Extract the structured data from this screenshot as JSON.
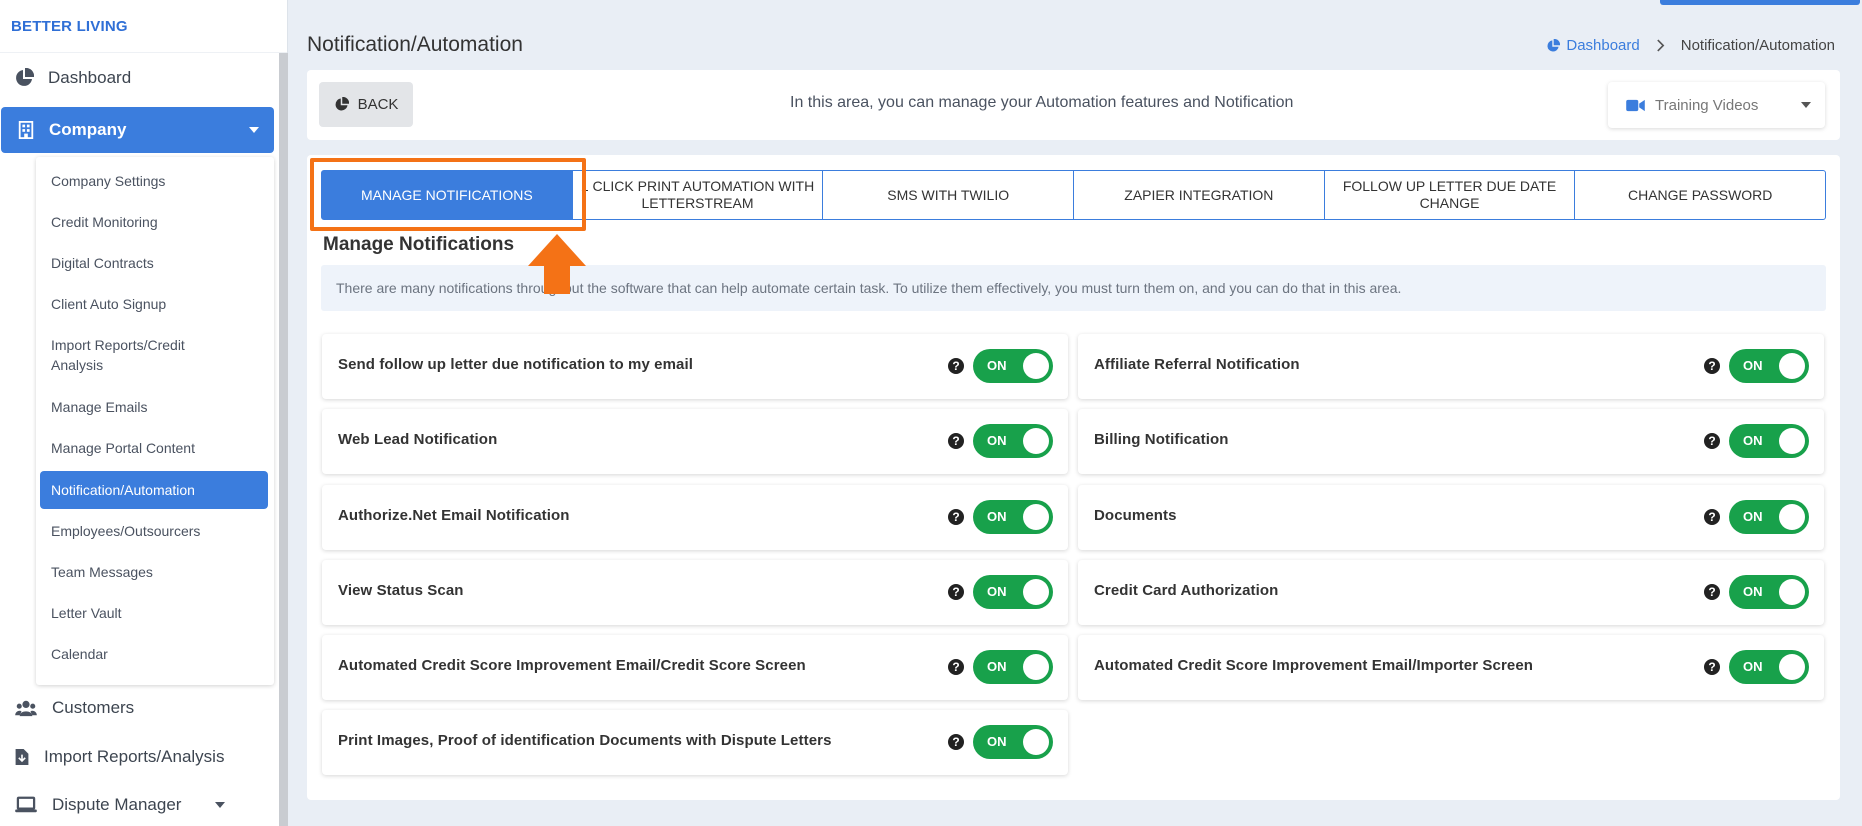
{
  "sidebar": {
    "brand": "BETTER LIVING",
    "items": [
      {
        "label": "Dashboard",
        "icon": "pie-chart-icon"
      },
      {
        "label": "Company",
        "icon": "building-icon"
      },
      {
        "label": "Customers",
        "icon": "users-icon"
      },
      {
        "label": "Import Reports/Analysis",
        "icon": "file-import-icon"
      },
      {
        "label": "Dispute Manager",
        "icon": "laptop-icon"
      }
    ],
    "company_submenu": [
      "Company Settings",
      "Credit Monitoring",
      "Digital Contracts",
      "Client Auto Signup",
      "Import Reports/Credit Analysis",
      "Manage Emails",
      "Manage Portal Content",
      "Notification/Automation",
      "Employees/Outsourcers",
      "Team Messages",
      "Letter Vault",
      "Calendar"
    ]
  },
  "header": {
    "title": "Notification/Automation",
    "breadcrumb": [
      "Dashboard",
      "Notification/Automation"
    ]
  },
  "topbar": {
    "back_label": "BACK",
    "info": "In this area, you can manage your Automation features and Notification",
    "training_label": "Training Videos"
  },
  "tabs": [
    {
      "label": "MANAGE NOTIFICATIONS",
      "active": true
    },
    {
      "label": "1 CLICK PRINT AUTOMATION WITH LETTERSTREAM",
      "active": false
    },
    {
      "label": "SMS WITH TWILIO",
      "active": false
    },
    {
      "label": "ZAPIER INTEGRATION",
      "active": false
    },
    {
      "label": "FOLLOW UP LETTER DUE DATE CHANGE",
      "active": false
    },
    {
      "label": "CHANGE PASSWORD",
      "active": false
    }
  ],
  "section": {
    "title": "Manage Notifications",
    "info": "There are many notifications throughout the software that can help automate certain task. To utilize them effectively, you must turn them on, and you can do that in this area."
  },
  "notifications": [
    {
      "label": "Send follow up letter due notification to my email",
      "state": "ON"
    },
    {
      "label": "Affiliate Referral Notification",
      "state": "ON"
    },
    {
      "label": "Web Lead Notification",
      "state": "ON"
    },
    {
      "label": "Billing Notification",
      "state": "ON"
    },
    {
      "label": "Authorize.Net Email Notification",
      "state": "ON"
    },
    {
      "label": "Documents",
      "state": "ON"
    },
    {
      "label": "View Status Scan",
      "state": "ON"
    },
    {
      "label": "Credit Card Authorization",
      "state": "ON"
    },
    {
      "label": "Automated Credit Score Improvement Email/Credit Score Screen",
      "state": "ON"
    },
    {
      "label": "Automated Credit Score Improvement Email/Importer Screen",
      "state": "ON"
    },
    {
      "label": "Print Images, Proof of identification Documents with Dispute Letters",
      "state": "ON"
    }
  ],
  "help_glyph": "?",
  "colors": {
    "accent": "#3b7ddd",
    "toggle_on": "#18a14b",
    "highlight": "#f47216"
  }
}
